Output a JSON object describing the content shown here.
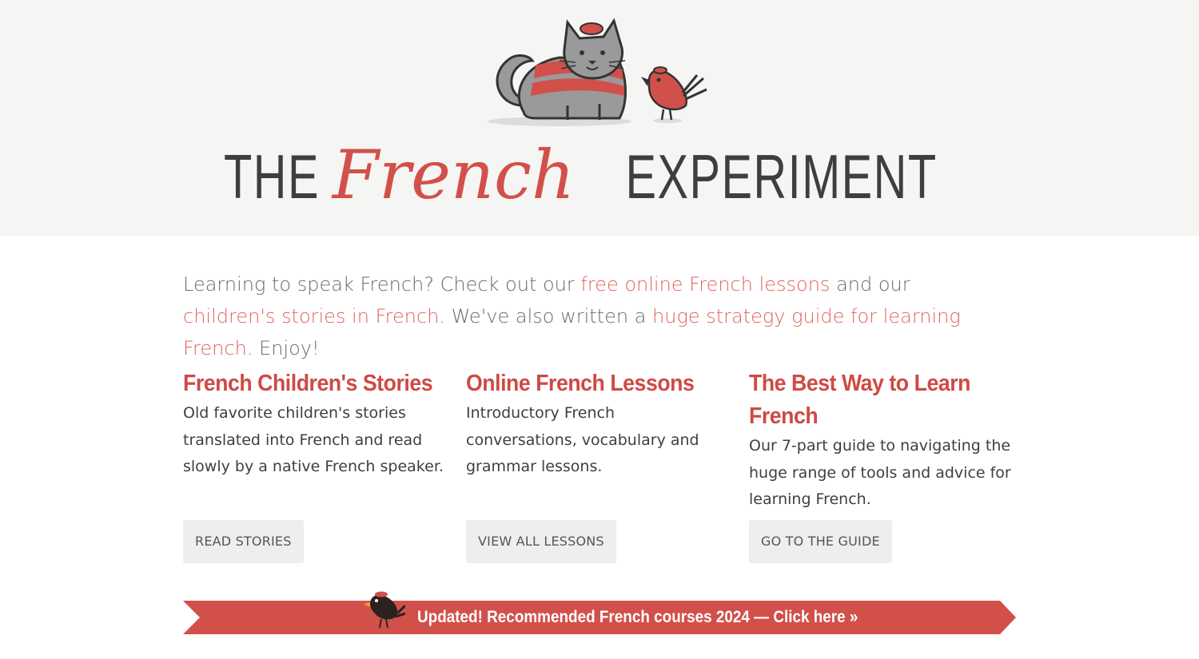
{
  "header": {
    "logo": {
      "word_the": "THE",
      "word_french": "French",
      "word_experiment": "EXPERIMENT"
    },
    "mascots": {
      "cat_icon": "cat-mascot-icon",
      "bird_icon": "bird-mascot-icon"
    }
  },
  "intro": {
    "text_1": "Learning to speak French? Check out our ",
    "link_lessons": "free online French lessons",
    "text_2": " and our ",
    "link_stories": "children's stories in French",
    "text_3": ". We've also written a ",
    "link_guide": "huge strategy guide for learning French",
    "text_4": ". Enjoy!"
  },
  "columns": [
    {
      "title": "French Children's Stories",
      "desc": "Old favorite children's stories translated into French and read slowly by a native French speaker.",
      "button": "READ STORIES"
    },
    {
      "title": "Online French Lessons",
      "desc": "Introductory French conversations, vocabulary and grammar lessons.",
      "button": "VIEW ALL LESSONS"
    },
    {
      "title": "The Best Way to Learn French",
      "desc": "Our 7-part guide to navigating the huge range of tools and advice for learning French.",
      "button": "GO TO THE GUIDE"
    }
  ],
  "banner": {
    "text": "Updated! Recommended French courses 2024 — Click here »",
    "icon": "blackbird-icon"
  },
  "colors": {
    "accent": "#d2504a",
    "link": "#e0635d",
    "header_bg": "#f5f5f3",
    "button_bg": "#eeeeec"
  }
}
